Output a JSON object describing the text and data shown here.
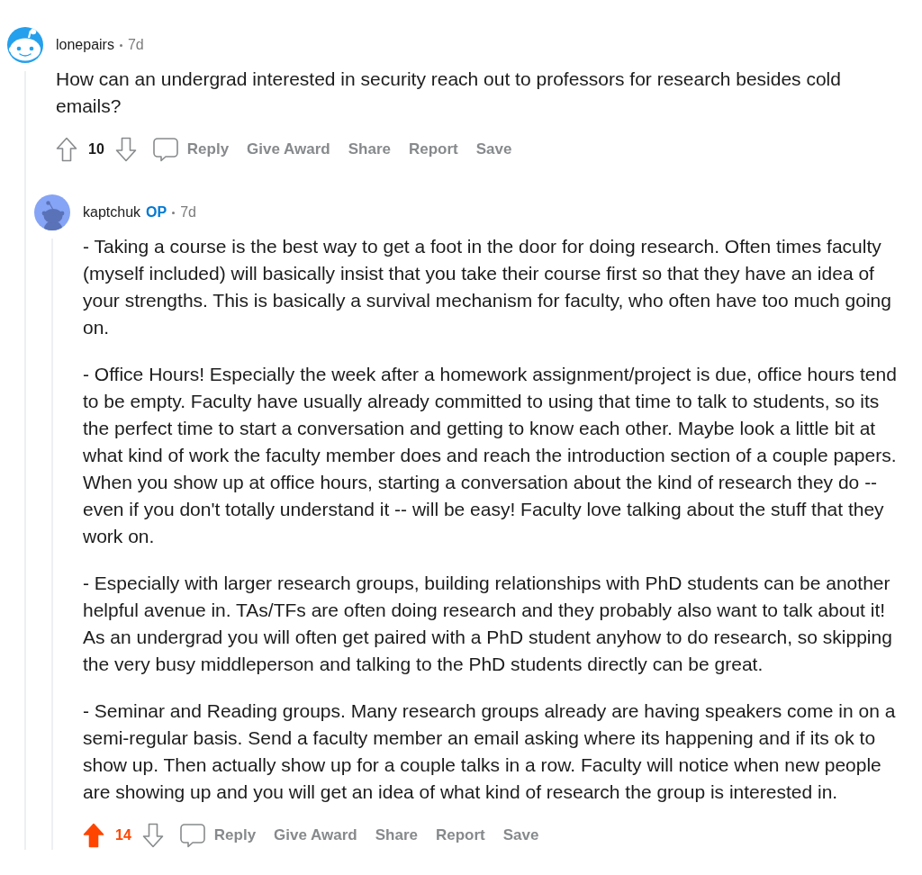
{
  "comments": [
    {
      "author": "lonepairs",
      "time": "7d",
      "avatar": {
        "kind": "face",
        "color": "#24a0ed"
      },
      "body": [
        "How can an undergrad interested in security reach out to professors for research besides cold emails?"
      ],
      "upvoted": false,
      "score": "10",
      "actions": [
        {
          "kind": "reply",
          "label": "Reply"
        },
        {
          "kind": "give-award",
          "label": "Give Award"
        },
        {
          "kind": "share",
          "label": "Share"
        },
        {
          "kind": "report",
          "label": "Report"
        },
        {
          "kind": "save",
          "label": "Save"
        }
      ],
      "replies": [
        {
          "author": "kaptchuk",
          "op_label": "OP",
          "time": "7d",
          "avatar": {
            "kind": "silhouette",
            "color": "#86a4f5"
          },
          "body": [
            "- Taking a course is the best way to get a foot in the door for doing research. Often times faculty (myself included) will basically insist that you take their course first so that they have an idea of your strengths. This is basically a survival mechanism for faculty, who often have too much going on.",
            "- Office Hours! Especially the week after a homework assignment/project is due, office hours tend to be empty. Faculty have usually already committed to using that time to talk to students, so its the perfect time to start a conversation and getting to know each other. Maybe look a little bit at what kind of work the faculty member does and reach the introduction section of a couple papers. When you show up at office hours, starting a conversation about the kind of research they do -- even if you don't totally understand it -- will be easy! Faculty love talking about the stuff that they work on.",
            "- Especially with larger research groups, building relationships with PhD students can be another helpful avenue in. TAs/TFs are often doing research and they probably also want to talk about it! As an undergrad you will often get paired with a PhD student anyhow to do research, so skipping the very busy middleperson and talking to the PhD students directly can be great.",
            "- Seminar and Reading groups. Many research groups already are having speakers come in on a semi-regular basis. Send a faculty member an email asking where its happening and if its ok to show up. Then actually show up for a couple talks in a row. Faculty will notice when new people are showing up and you will get an idea of what kind of research the group is interested in."
          ],
          "upvoted": true,
          "score": "14",
          "actions": [
            {
              "kind": "reply",
              "label": "Reply"
            },
            {
              "kind": "give-award",
              "label": "Give Award"
            },
            {
              "kind": "share",
              "label": "Share"
            },
            {
              "kind": "report",
              "label": "Report"
            },
            {
              "kind": "save",
              "label": "Save"
            }
          ]
        }
      ]
    }
  ]
}
